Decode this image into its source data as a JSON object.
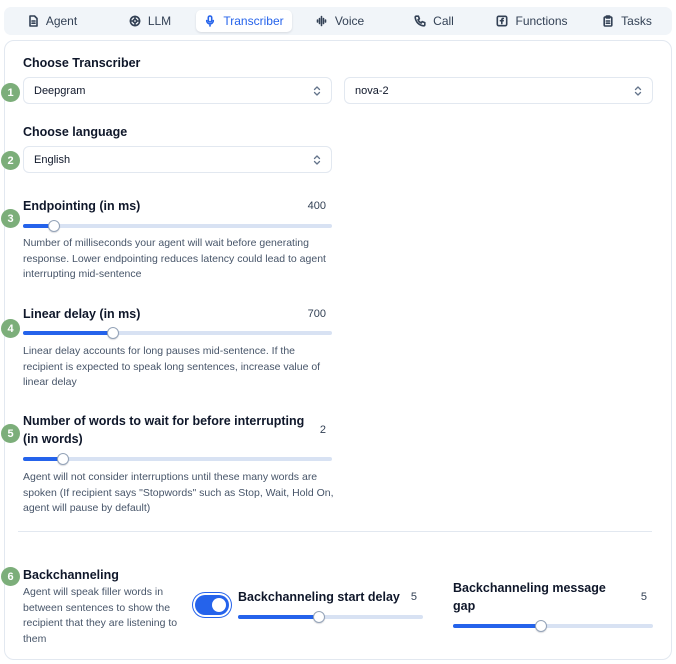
{
  "tabs": [
    {
      "label": "Agent",
      "icon": "document-icon"
    },
    {
      "label": "LLM",
      "icon": "openai-icon"
    },
    {
      "label": "Transcriber",
      "icon": "microphone-icon"
    },
    {
      "label": "Voice",
      "icon": "waveform-icon"
    },
    {
      "label": "Call",
      "icon": "phone-icon"
    },
    {
      "label": "Functions",
      "icon": "function-icon"
    },
    {
      "label": "Tasks",
      "icon": "clipboard-icon"
    }
  ],
  "active_tab": "Transcriber",
  "colors": {
    "accent": "#2563eb",
    "badge": "#7cae7a",
    "track": "#d8e2f3"
  },
  "sections": {
    "transcriber": {
      "step": "1",
      "heading": "Choose Transcriber",
      "provider": "Deepgram",
      "model": "nova-2"
    },
    "language": {
      "step": "2",
      "heading": "Choose language",
      "value": "English"
    },
    "endpointing": {
      "step": "3",
      "label": "Endpointing (in ms)",
      "value": "400",
      "level": 0.1,
      "description": "Number of milliseconds your agent will wait before generating response. Lower endpointing reduces latency could lead to agent interrupting mid-sentence"
    },
    "linear_delay": {
      "step": "4",
      "label": "Linear delay (in ms)",
      "value": "700",
      "level": 0.29,
      "description": "Linear delay accounts for long pauses mid-sentence. If the recipient is expected to speak long sentences, increase value of linear delay"
    },
    "interrupt_words": {
      "step": "5",
      "label_line1": "Number of words to wait for before interrupting",
      "label_line2": "(in words)",
      "value": "2",
      "level": 0.13,
      "description": "Agent will not consider interruptions until these many words are spoken (If recipient says \"Stopwords\" such as Stop, Wait, Hold On, agent will pause by default)"
    },
    "backchanneling": {
      "step": "6",
      "heading": "Backchanneling",
      "description": "Agent will speak filler words in between sentences to show the recipient that they are listening to them",
      "enabled": true,
      "start_delay": {
        "label": "Backchanneling start delay",
        "value": "5",
        "level": 0.44
      },
      "message_gap": {
        "label_line1": "Backchanneling message",
        "label_line2": "gap",
        "value": "5",
        "level": 0.44
      }
    }
  }
}
